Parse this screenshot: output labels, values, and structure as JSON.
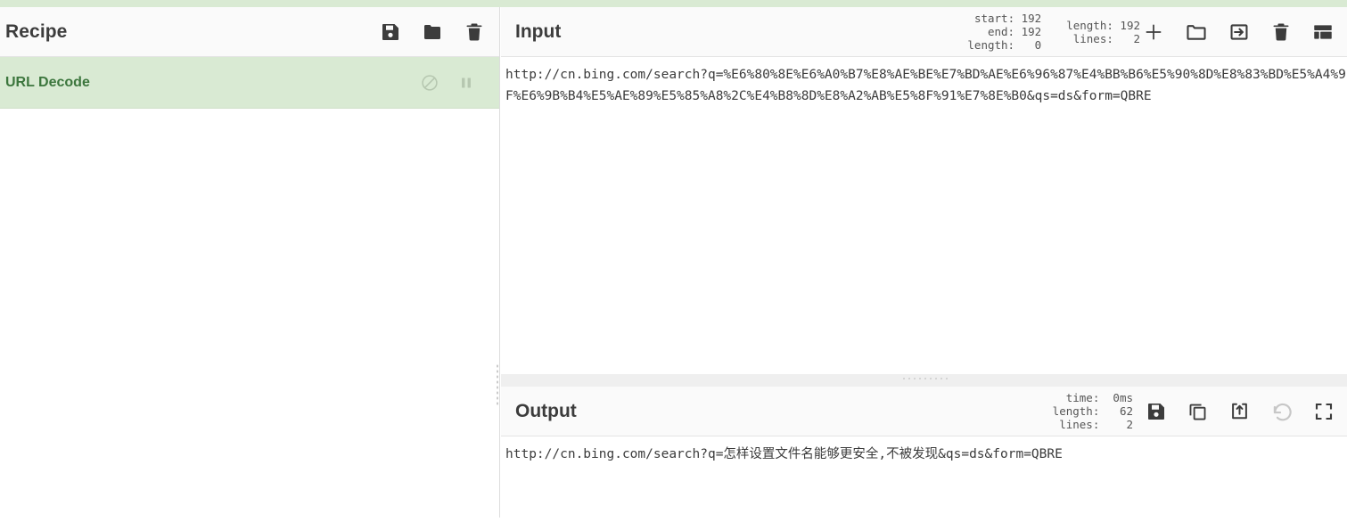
{
  "theme": {
    "accent_green": "#d9ead3",
    "op_text_green": "#3c763d",
    "panel_header_bg": "#fafafa",
    "text_color": "#3c3c3c",
    "disabled_icon": "#c7c7c7"
  },
  "recipe": {
    "title": "Recipe",
    "actions": [
      {
        "name": "save-recipe",
        "icon": "save-icon"
      },
      {
        "name": "load-recipe",
        "icon": "folder-icon"
      },
      {
        "name": "clear-recipe",
        "icon": "trash-icon"
      }
    ],
    "operations": [
      {
        "name": "URL Decode",
        "disable_icon": "disable-icon",
        "pause_icon": "pause-icon"
      }
    ]
  },
  "input": {
    "title": "Input",
    "selection_stats": {
      "start_label": "start:",
      "start_value": "192",
      "end_label": "end:",
      "end_value": "192",
      "length_label": "length:",
      "length_value": "0"
    },
    "content_stats": {
      "length_label": "length:",
      "length_value": "192",
      "lines_label": "lines:",
      "lines_value": "2"
    },
    "actions": [
      {
        "name": "add-input-tab",
        "icon": "plus-icon"
      },
      {
        "name": "open-file-as-input",
        "icon": "folder-open-icon"
      },
      {
        "name": "open-folder-as-input",
        "icon": "arrow-into-box-icon"
      },
      {
        "name": "clear-input",
        "icon": "trash-icon"
      },
      {
        "name": "reset-pane-layout",
        "icon": "panel-layout-icon"
      }
    ],
    "text": "http://cn.bing.com/search?q=%E6%80%8E%E6%A0%B7%E8%AE%BE%E7%BD%AE%E6%96%87%E4%BB%B6%E5%90%8D%E8%83%BD%E5%A4%9F%E6%9B%B4%E5%AE%89%E5%85%A8%2C%E4%B8%8D%E8%A2%AB%E5%8F%91%E7%8E%B0&qs=ds&form=QBRE"
  },
  "output": {
    "title": "Output",
    "stats": {
      "time_label": "time:",
      "time_value": "0ms",
      "length_label": "length:",
      "length_value": "62",
      "lines_label": "lines:",
      "lines_value": "2"
    },
    "actions": [
      {
        "name": "save-output",
        "icon": "save-icon"
      },
      {
        "name": "copy-output",
        "icon": "copy-icon"
      },
      {
        "name": "replace-input-with-output",
        "icon": "open-in-new-icon"
      },
      {
        "name": "undo-bake",
        "icon": "undo-icon",
        "disabled": true
      },
      {
        "name": "maximise-output",
        "icon": "fullscreen-icon"
      }
    ],
    "text": "http://cn.bing.com/search?q=怎样设置文件名能够更安全,不被发现&qs=ds&form=QBRE"
  }
}
